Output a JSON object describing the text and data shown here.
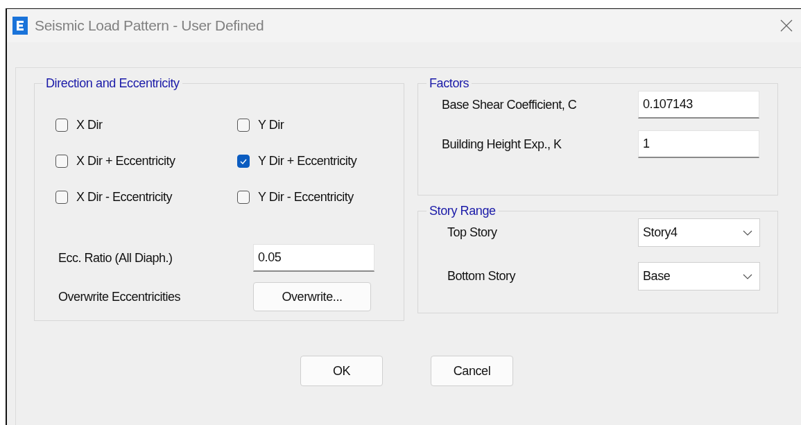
{
  "window": {
    "title": "Seismic Load Pattern - User Defined"
  },
  "direction_and_eccentricity": {
    "title": "Direction and Eccentricity",
    "checkboxes": [
      {
        "label": "X Dir",
        "checked": false
      },
      {
        "label": "Y Dir",
        "checked": false
      },
      {
        "label": "X Dir + Eccentricity",
        "checked": false
      },
      {
        "label": "Y Dir + Eccentricity",
        "checked": true
      },
      {
        "label": "X Dir - Eccentricity",
        "checked": false
      },
      {
        "label": "Y Dir - Eccentricity",
        "checked": false
      }
    ],
    "ecc_ratio": {
      "label": "Ecc. Ratio (All Diaph.)",
      "value": "0.05"
    },
    "overwrite": {
      "label": "Overwrite Eccentricities",
      "button": "Overwrite..."
    }
  },
  "factors": {
    "title": "Factors",
    "fields": [
      {
        "label": "Base Shear Coefficient, C",
        "value": "0.107143"
      },
      {
        "label": "Building Height Exp., K",
        "value": "1"
      }
    ]
  },
  "story_range": {
    "title": "Story Range",
    "dropdowns": [
      {
        "label": "Top Story",
        "value": "Story4"
      },
      {
        "label": "Bottom Story",
        "value": "Base"
      }
    ]
  },
  "buttons": [
    "OK",
    "Cancel"
  ]
}
